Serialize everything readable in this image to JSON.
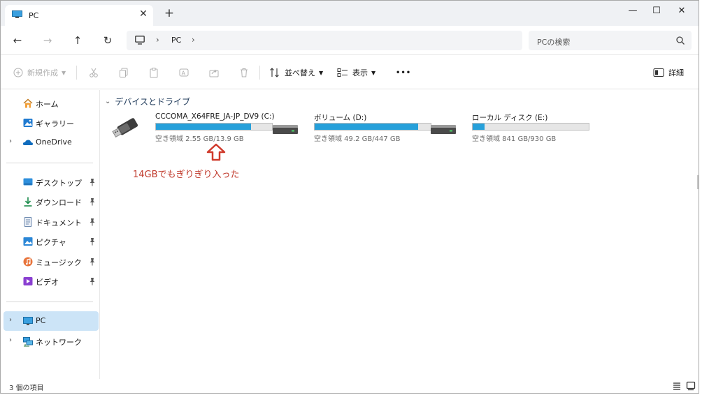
{
  "tab": {
    "title": "PC",
    "close": "✕",
    "add": "+"
  },
  "window_controls": {
    "minimize": "—",
    "maximize": "☐",
    "close": "✕"
  },
  "nav": {
    "back": "←",
    "forward": "→",
    "up": "↑",
    "refresh": "↻"
  },
  "address": {
    "path": [
      "PC"
    ],
    "sep": "›"
  },
  "search": {
    "placeholder": "PCの検索"
  },
  "commands": {
    "new": "新規作成",
    "sort": "並べ替え",
    "view": "表示",
    "more": "•••",
    "details": "詳細"
  },
  "sidebar": {
    "items": [
      {
        "label": "ホーム",
        "icon": "home-icon"
      },
      {
        "label": "ギャラリー",
        "icon": "gallery-icon"
      },
      {
        "label": "OneDrive",
        "icon": "onedrive-icon",
        "expandable": true
      },
      {
        "label": "デスクトップ",
        "icon": "desktop-icon",
        "pinned": true
      },
      {
        "label": "ダウンロード",
        "icon": "download-icon",
        "pinned": true
      },
      {
        "label": "ドキュメント",
        "icon": "document-icon",
        "pinned": true
      },
      {
        "label": "ピクチャ",
        "icon": "pictures-icon",
        "pinned": true
      },
      {
        "label": "ミュージック",
        "icon": "music-icon",
        "pinned": true
      },
      {
        "label": "ビデオ",
        "icon": "video-icon",
        "pinned": true
      },
      {
        "label": "PC",
        "icon": "pc-icon",
        "expandable": true,
        "selected": true
      },
      {
        "label": "ネットワーク",
        "icon": "network-icon",
        "expandable": true
      }
    ]
  },
  "main": {
    "section_title": "デバイスとドライブ",
    "drives": [
      {
        "name": "CCCOMA_X64FRE_JA-JP_DV9 (C:)",
        "free": "空き領域 2.55 GB/13.9 GB",
        "used_fraction": 0.82,
        "icon": "usb-drive-icon"
      },
      {
        "name": "ボリューム (D:)",
        "free": "空き領域 49.2 GB/447 GB",
        "used_fraction": 0.89,
        "icon": "hard-drive-icon"
      },
      {
        "name": "ローカル ディスク (E:)",
        "free": "空き領域 841 GB/930 GB",
        "used_fraction": 0.1,
        "icon": "hard-drive-icon"
      }
    ],
    "annotation": "14GBでもぎりぎり入った"
  },
  "status": {
    "count": "3 個の項目"
  },
  "colors": {
    "accent": "#26a0da",
    "selected": "#cce4f7",
    "annotation": "#c0392b"
  }
}
